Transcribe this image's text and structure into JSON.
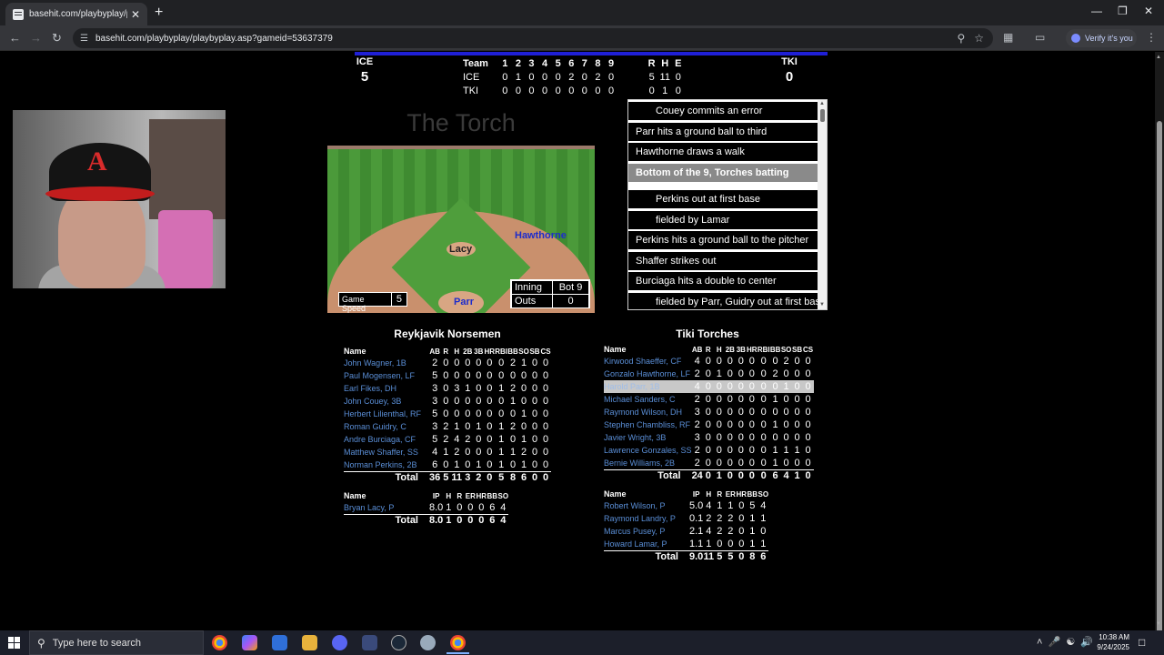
{
  "browser": {
    "tab_title": "basehit.com/playbyplay/playby",
    "tab_close": "✕",
    "new_tab": "+",
    "url": "basehit.com/playbyplay/playbyplay.asp?gameid=53637379",
    "verify_label": "Verify it's you",
    "window_controls": {
      "minimize": "—",
      "maximize": "❐",
      "close": "✕"
    }
  },
  "scoreboard": {
    "away_abbr": "ICE",
    "away_runs": "5",
    "home_abbr": "TKI",
    "home_runs": "0",
    "line_header": [
      "Team",
      "1",
      "2",
      "3",
      "4",
      "5",
      "6",
      "7",
      "8",
      "9",
      "R",
      "H",
      "E"
    ],
    "line_rows": [
      [
        "ICE",
        "0",
        "1",
        "0",
        "0",
        "0",
        "2",
        "0",
        "2",
        "0",
        "5",
        "11",
        "0"
      ],
      [
        "TKI",
        "0",
        "0",
        "0",
        "0",
        "0",
        "0",
        "0",
        "0",
        "0",
        "0",
        "1",
        "0"
      ]
    ]
  },
  "field": {
    "title": "The Torch",
    "pitcher": "Lacy",
    "runner_second": "Hawthorne",
    "batter": "Parr",
    "game_speed_label": "Game Speed",
    "game_speed_value": "5",
    "inning_label": "Inning",
    "inning_value": "Bot 9",
    "outs_label": "Outs",
    "outs_value": "0"
  },
  "playlog": [
    {
      "text": "Couey commits an error",
      "style": "indent"
    },
    {
      "text": "Parr hits a ground ball to third",
      "style": "normal"
    },
    {
      "text": "Hawthorne draws a walk",
      "style": "normal"
    },
    {
      "text": "Bottom of the 9, Torches batting",
      "style": "header"
    },
    {
      "text": "Perkins out at first base",
      "style": "indent"
    },
    {
      "text": "fielded by Lamar",
      "style": "indent"
    },
    {
      "text": "Perkins hits a ground ball to the pitcher",
      "style": "normal"
    },
    {
      "text": "Shaffer strikes out",
      "style": "normal"
    },
    {
      "text": "Burciaga hits a double to center",
      "style": "normal"
    },
    {
      "text": "fielded by Parr, Guidry out at first base",
      "style": "indent"
    }
  ],
  "away_box": {
    "team_name": "Reykjavik Norsemen",
    "batting_headers": [
      "Name",
      "AB",
      "R",
      "H",
      "2B",
      "3B",
      "HR",
      "RBI",
      "BB",
      "SO",
      "SB",
      "CS"
    ],
    "batters": [
      [
        "John Wagner, 1B",
        "2",
        "0",
        "0",
        "0",
        "0",
        "0",
        "0",
        "2",
        "1",
        "0",
        "0"
      ],
      [
        "Paul Mogensen, LF",
        "5",
        "0",
        "0",
        "0",
        "0",
        "0",
        "0",
        "0",
        "0",
        "0",
        "0"
      ],
      [
        "Earl Fikes, DH",
        "3",
        "0",
        "3",
        "1",
        "0",
        "0",
        "1",
        "2",
        "0",
        "0",
        "0"
      ],
      [
        "John Couey, 3B",
        "3",
        "0",
        "0",
        "0",
        "0",
        "0",
        "0",
        "1",
        "0",
        "0",
        "0"
      ],
      [
        "Herbert Lilienthal, RF",
        "5",
        "0",
        "0",
        "0",
        "0",
        "0",
        "0",
        "0",
        "1",
        "0",
        "0"
      ],
      [
        "Roman Guidry, C",
        "3",
        "2",
        "1",
        "0",
        "1",
        "0",
        "1",
        "2",
        "0",
        "0",
        "0"
      ],
      [
        "Andre Burciaga, CF",
        "5",
        "2",
        "4",
        "2",
        "0",
        "0",
        "1",
        "0",
        "1",
        "0",
        "0"
      ],
      [
        "Matthew Shaffer, SS",
        "4",
        "1",
        "2",
        "0",
        "0",
        "0",
        "1",
        "1",
        "2",
        "0",
        "0"
      ],
      [
        "Norman Perkins, 2B",
        "6",
        "0",
        "1",
        "0",
        "1",
        "0",
        "1",
        "0",
        "1",
        "0",
        "0"
      ]
    ],
    "batting_total": [
      "Total",
      "36",
      "5",
      "11",
      "3",
      "2",
      "0",
      "5",
      "8",
      "6",
      "0",
      "0"
    ],
    "pitching_headers": [
      "Name",
      "IP",
      "H",
      "R",
      "ER",
      "HR",
      "BB",
      "SO"
    ],
    "pitchers": [
      [
        "Bryan Lacy, P",
        "8.0",
        "1",
        "0",
        "0",
        "0",
        "6",
        "4"
      ]
    ],
    "pitching_total": [
      "Total",
      "8.0",
      "1",
      "0",
      "0",
      "0",
      "6",
      "4"
    ]
  },
  "home_box": {
    "team_name": "Tiki Torches",
    "batting_headers": [
      "Name",
      "AB",
      "R",
      "H",
      "2B",
      "3B",
      "HR",
      "RBI",
      "BB",
      "SO",
      "SB",
      "CS"
    ],
    "batters": [
      [
        "Kirwood Shaeffer, CF",
        "4",
        "0",
        "0",
        "0",
        "0",
        "0",
        "0",
        "0",
        "2",
        "0",
        "0"
      ],
      [
        "Gonzalo Hawthorne, LF",
        "2",
        "0",
        "1",
        "0",
        "0",
        "0",
        "0",
        "2",
        "0",
        "0",
        "0"
      ],
      [
        "Harold Parr, 1B",
        "4",
        "0",
        "0",
        "0",
        "0",
        "0",
        "0",
        "0",
        "1",
        "0",
        "0"
      ],
      [
        "Michael Sanders, C",
        "2",
        "0",
        "0",
        "0",
        "0",
        "0",
        "0",
        "1",
        "0",
        "0",
        "0"
      ],
      [
        "Raymond Wilson, DH",
        "3",
        "0",
        "0",
        "0",
        "0",
        "0",
        "0",
        "0",
        "0",
        "0",
        "0"
      ],
      [
        "Stephen Chambliss, RF",
        "2",
        "0",
        "0",
        "0",
        "0",
        "0",
        "0",
        "1",
        "0",
        "0",
        "0"
      ],
      [
        "Javier Wright, 3B",
        "3",
        "0",
        "0",
        "0",
        "0",
        "0",
        "0",
        "0",
        "0",
        "0",
        "0"
      ],
      [
        "Lawrence Gonzales, SS",
        "2",
        "0",
        "0",
        "0",
        "0",
        "0",
        "0",
        "1",
        "1",
        "1",
        "0"
      ],
      [
        "Bernie Williams, 2B",
        "2",
        "0",
        "0",
        "0",
        "0",
        "0",
        "0",
        "1",
        "0",
        "0",
        "0"
      ]
    ],
    "highlight_row": 2,
    "batting_total": [
      "Total",
      "24",
      "0",
      "1",
      "0",
      "0",
      "0",
      "0",
      "6",
      "4",
      "1",
      "0"
    ],
    "pitching_headers": [
      "Name",
      "IP",
      "H",
      "R",
      "ER",
      "HR",
      "BB",
      "SO"
    ],
    "pitchers": [
      [
        "Robert Wilson, P",
        "5.0",
        "4",
        "1",
        "1",
        "0",
        "5",
        "4"
      ],
      [
        "Raymond Landry, P",
        "0.1",
        "2",
        "2",
        "2",
        "0",
        "1",
        "1"
      ],
      [
        "Marcus Pusey, P",
        "2.1",
        "4",
        "2",
        "2",
        "0",
        "1",
        "0"
      ],
      [
        "Howard Lamar, P",
        "1.1",
        "1",
        "0",
        "0",
        "0",
        "1",
        "1"
      ]
    ],
    "pitching_total": [
      "Total",
      "9.0",
      "11",
      "5",
      "5",
      "0",
      "8",
      "6"
    ]
  },
  "taskbar": {
    "search_placeholder": "Type here to search",
    "time": "10:38 AM",
    "date": "9/24/2025",
    "apps": [
      "chrome-icon",
      "copilot-icon",
      "store-icon",
      "file-explorer-icon",
      "discord-icon",
      "keyboard-app-icon",
      "steam-icon",
      "browser-icon",
      "chrome-active-icon"
    ]
  }
}
